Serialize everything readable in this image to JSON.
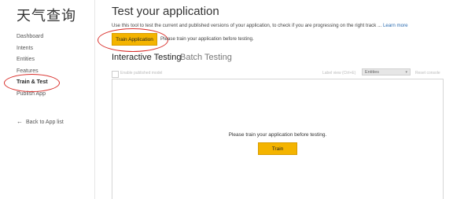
{
  "sidebar": {
    "app_title": "天气查询",
    "items": [
      {
        "label": "Dashboard"
      },
      {
        "label": "Intents"
      },
      {
        "label": "Entities"
      },
      {
        "label": "Features"
      },
      {
        "label": "Train & Test"
      },
      {
        "label": "Publish App"
      }
    ],
    "active_item": "Train & Test",
    "back_link": "Back to App list",
    "back_icon": "arrow-left-icon"
  },
  "main": {
    "title": "Test your application",
    "description": "Use this tool to test the current and published versions of your application, to check if you are progressing on the right track ...",
    "learn_more": "Learn more",
    "train_application_button": "Train Application",
    "train_note": "Please train your application before testing.",
    "tabs": [
      {
        "label": "Interactive Testing",
        "active": true
      },
      {
        "label": "Batch Testing",
        "active": false
      }
    ],
    "toolbar": {
      "enable_published_label": "Enable published model",
      "compare_label": "Label view (Ctrl+E)",
      "select_value": "Entities",
      "reset_label": "Reset console"
    },
    "panel": {
      "message": "Please train your application before testing.",
      "train_button": "Train"
    }
  },
  "colors": {
    "accent": "#f4b400",
    "annotation": "#d9302c",
    "link": "#2b6cb0"
  }
}
